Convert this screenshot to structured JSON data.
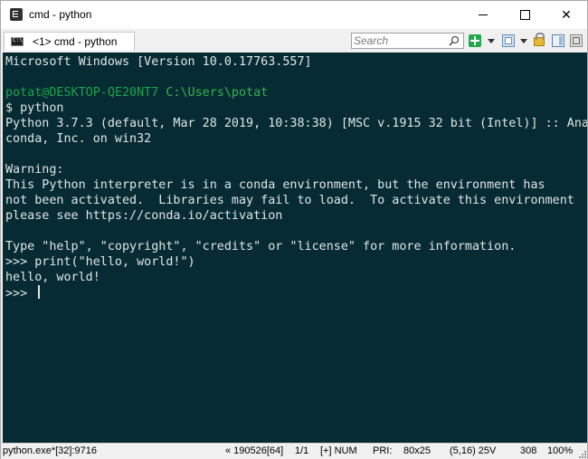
{
  "window": {
    "title": "cmd - python",
    "icon": "conemu-app-icon"
  },
  "controls": {
    "minimize": "minimize",
    "maximize": "maximize",
    "close": "✕"
  },
  "tabs": [
    {
      "label": "<1> cmd - python",
      "icon": "console-icon"
    }
  ],
  "search": {
    "placeholder": "Search",
    "value": ""
  },
  "console": {
    "background": "#072b33",
    "foreground": "#dfe6e8",
    "prompt_color": "#1aa34a",
    "lines": [
      "Microsoft Windows [Version 10.0.17763.557]",
      "",
      "",
      "$ python",
      "Python 3.7.3 (default, Mar 28 2019, 10:38:38) [MSC v.1915 32 bit (Intel)] :: Ana",
      "conda, Inc. on win32",
      "",
      "Warning:",
      "This Python interpreter is in a conda environment, but the environment has",
      "not been activated.  Libraries may fail to load.  To activate this environment",
      "please see https://conda.io/activation",
      "",
      "Type \"help\", \"copyright\", \"credits\" or \"license\" for more information.",
      ">>> print(\"hello, world!\")",
      "hello, world!",
      ">>> "
    ],
    "prompt": {
      "user_host": "potat@DESKTOP-QE20NT7",
      "path": "C:\\Users\\potat"
    }
  },
  "statusbar": {
    "process": "python.exe*[32]:9716",
    "position": "« 190526[64]",
    "pages": "1/1",
    "mode": "[+] NUM",
    "priority": "PRI:",
    "size": "80x25",
    "cursor": "(5,16) 25V",
    "cursor_size": "308",
    "zoom": "100%"
  }
}
